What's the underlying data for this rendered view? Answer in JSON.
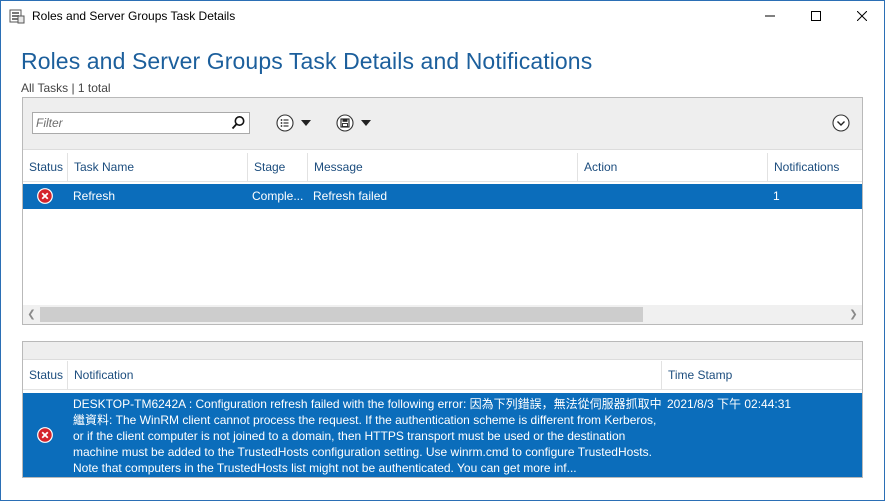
{
  "window": {
    "title": "Roles and Server Groups Task Details"
  },
  "page": {
    "title": "Roles and Server Groups Task Details and Notifications",
    "subtitle": "All Tasks | 1 total"
  },
  "toolbar": {
    "filter_placeholder": "Filter"
  },
  "tasks": {
    "columns": [
      "Status",
      "Task Name",
      "Stage",
      "Message",
      "Action",
      "Notifications"
    ],
    "rows": [
      {
        "status": "error",
        "task_name": "Refresh",
        "stage": "Comple...",
        "message": "Refresh failed",
        "action": "",
        "notifications": "1"
      }
    ]
  },
  "notifications": {
    "columns": [
      "Status",
      "Notification",
      "Time Stamp"
    ],
    "rows": [
      {
        "status": "error",
        "text": "DESKTOP-TM6242A : Configuration refresh failed with the following error: 因為下列錯誤，無法從伺服器抓取中繼資料: The WinRM client cannot process the request. If the authentication scheme is different from Kerberos, or if the client computer is not joined to a domain, then HTTPS transport must be used or the destination machine must be added to the TrustedHosts configuration setting. Use winrm.cmd to configure TrustedHosts. Note that computers in the TrustedHosts list might not be authenticated. You can get more inf...",
        "timestamp": "2021/8/3 下午 02:44:31"
      }
    ]
  },
  "colors": {
    "accent": "#1c5f9c",
    "selection": "#0b6dbb",
    "error": "#d4232b"
  }
}
